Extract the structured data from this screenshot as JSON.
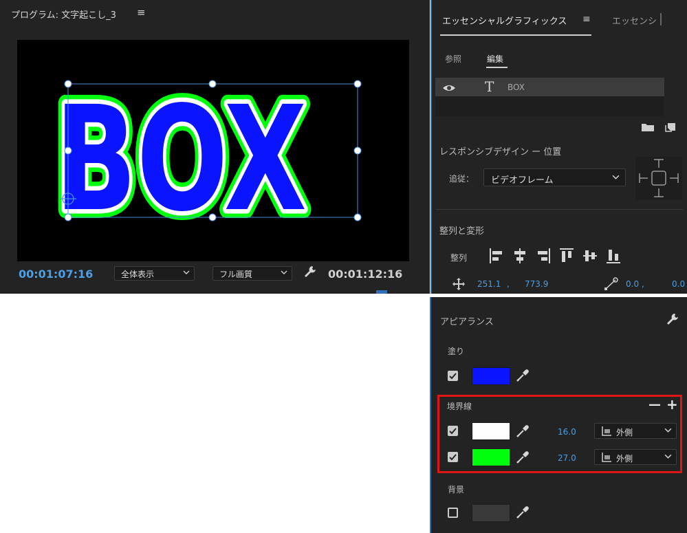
{
  "program_monitor": {
    "title": "プログラム: 文字起こし_3",
    "menu_icon": "hamburger-menu-icon",
    "viewer_text": "BOX",
    "current_timecode": "00:01:07:16",
    "duration_timecode": "00:01:12:16",
    "fit_select": "全体表示",
    "quality_select": "フル画質",
    "settings_icon": "wrench-icon"
  },
  "essential_graphics": {
    "tab_active": "エッセンシャルグラフィックス",
    "tab_menu_icon": "hamburger-menu-icon",
    "tab_other": "エッセンシ",
    "subtab_browse": "参照",
    "subtab_edit": "編集",
    "layer": {
      "name": "BOX",
      "visibility_icon": "eye-icon",
      "type_icon": "text-type-icon"
    },
    "responsive_design": {
      "title": "レスポンシブデザイン ー 位置",
      "follow_label": "追従：",
      "follow_value": "ビデオフレーム"
    },
    "align_transform": {
      "title": "整列と変形",
      "align_label": "整列",
      "position_x": "251.1",
      "position_y": "773.9",
      "anchor_x": "0.0",
      "anchor_y": "0.0",
      "separator": ","
    }
  },
  "appearance": {
    "title": "アピアランス",
    "fill": {
      "label": "塗り",
      "enabled": true,
      "color": "#0a14ff"
    },
    "stroke": {
      "label": "境界線",
      "items": [
        {
          "enabled": true,
          "color": "#ffffff",
          "width": "16.0",
          "position": "外側"
        },
        {
          "enabled": true,
          "color": "#00ff0c",
          "width": "27.0",
          "position": "外側"
        }
      ]
    },
    "background": {
      "label": "背景",
      "enabled": false,
      "color": "#4a4a4a"
    }
  },
  "colors": {
    "accent_blue": "#4a9fe6",
    "highlight_red": "#e01515",
    "panel_bg": "#232323"
  }
}
